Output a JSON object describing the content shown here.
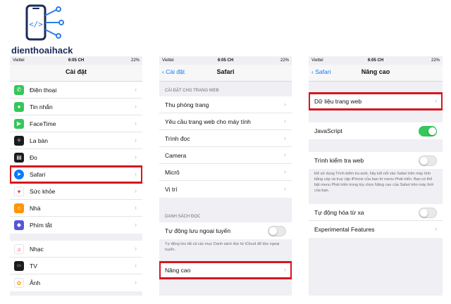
{
  "brand": {
    "name": "dienthoaihack"
  },
  "status": {
    "carrier": "Viettel",
    "time": "6:05 CH",
    "battery": "22%"
  },
  "colors": {
    "highlight": "#d7161f",
    "ios_blue": "#0a7aff",
    "toggle_on": "#34c759"
  },
  "screen1": {
    "title": "Cài đặt",
    "group_a": [
      {
        "label": "Điện thoại",
        "icon": "phone-icon"
      },
      {
        "label": "Tin nhắn",
        "icon": "messages-icon"
      },
      {
        "label": "FaceTime",
        "icon": "facetime-icon"
      },
      {
        "label": "La bàn",
        "icon": "compass-icon"
      },
      {
        "label": "Đo",
        "icon": "measure-icon"
      },
      {
        "label": "Safari",
        "icon": "safari-icon"
      },
      {
        "label": "Sức khỏe",
        "icon": "health-icon"
      },
      {
        "label": "Nhà",
        "icon": "home-icon"
      },
      {
        "label": "Phím tắt",
        "icon": "shortcuts-icon"
      }
    ],
    "group_b": [
      {
        "label": "Nhạc",
        "icon": "music-icon"
      },
      {
        "label": "TV",
        "icon": "tv-icon"
      },
      {
        "label": "Ảnh",
        "icon": "photos-icon"
      }
    ]
  },
  "screen2": {
    "back": "Cài đặt",
    "title": "Safari",
    "section1": "CÀI ĐẶT CHO TRANG WEB",
    "items": [
      "Thu phóng trang",
      "Yêu cầu trang web cho máy tính",
      "Trình đọc",
      "Camera",
      "Micrô",
      "Vị trí"
    ],
    "section2": "DANH SÁCH ĐỌC",
    "auto_save": "Tự động lưu ngoại tuyến",
    "auto_save_note": "Tự động lưu tất cả các mục Danh sách đọc từ iCloud để đọc ngoại tuyến.",
    "advanced": "Nâng cao"
  },
  "screen3": {
    "back": "Safari",
    "title": "Nâng cao",
    "website_data": "Dữ liệu trang web",
    "javascript": "JavaScript",
    "web_inspector": "Trình kiểm tra web",
    "inspector_note": "Để sử dụng Trình kiểm tra web, hãy kết nối vào Safari trên máy tính bằng cáp và truy cập iPhone của bạn từ menu Phát triển. Bạn có thể bật menu Phát triển trong tùy chọn Nâng cao của Safari trên máy tính của bạn.",
    "remote_automation": "Tự động hóa từ xa",
    "experimental": "Experimental Features"
  }
}
